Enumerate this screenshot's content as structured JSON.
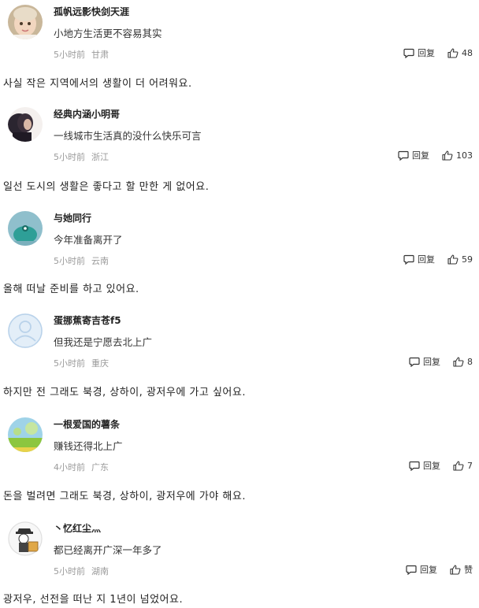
{
  "comments": [
    {
      "name": "孤帆远影快剑天涯",
      "text": "小地方生活更不容易其实",
      "time": "5小时前",
      "location": "甘肃",
      "reply_label": "回复",
      "likes": "48",
      "translation": "사실 작은 지역에서의 생활이 더 어려워요."
    },
    {
      "name": "经典内涵小明哥",
      "text": "一线城市生活真的没什么快乐可言",
      "time": "5小时前",
      "location": "浙江",
      "reply_label": "回复",
      "likes": "103",
      "translation": "일선 도시의 생활은 좋다고 할 만한 게 없어요."
    },
    {
      "name": "与她同行",
      "text": "今年准备离开了",
      "time": "5小时前",
      "location": "云南",
      "reply_label": "回复",
      "likes": "59",
      "translation": "올해 떠날 준비를 하고 있어요."
    },
    {
      "name": "蛋挪蕉寄吉苍f5",
      "text": "但我还是宁愿去北上广",
      "time": "5小时前",
      "location": "重庆",
      "reply_label": "回复",
      "likes": "8",
      "translation": "하지만 전 그래도 북경, 상하이, 광저우에 가고 싶어요."
    },
    {
      "name": "一根爱国的薯条",
      "text": "赚钱还得北上广",
      "time": "4小时前",
      "location": "广东",
      "reply_label": "回复",
      "likes": "7",
      "translation": "돈을 벌려면 그래도 북경, 상하이, 광저우에 가야 해요."
    },
    {
      "name": "丶忆红尘灬",
      "text": "都已经离开广深一年多了",
      "time": "5小时前",
      "location": "湖南",
      "reply_label": "回复",
      "likes": "赞",
      "translation": "광저우, 선전을 떠난 지 1년이 넘었어요."
    }
  ]
}
